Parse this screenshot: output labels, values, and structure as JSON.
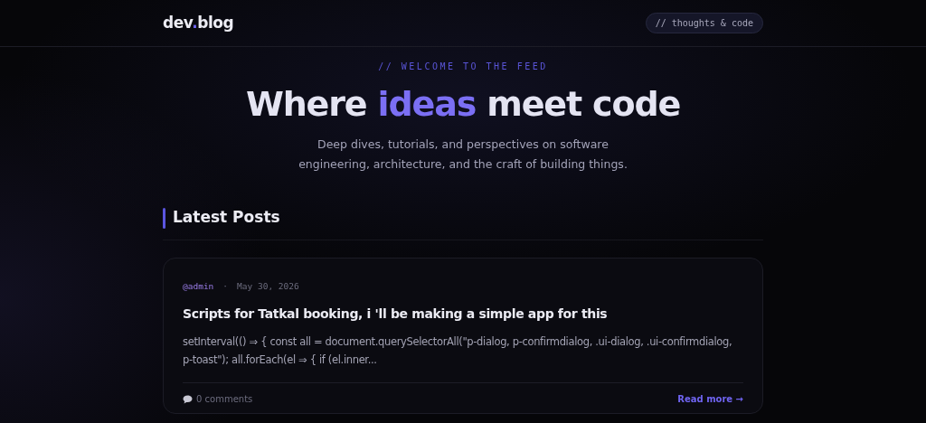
{
  "header": {
    "logo_parts": [
      {
        "text": "dev",
        "accent": false
      },
      {
        "text": ".",
        "accent": true
      },
      {
        "text": "blog",
        "accent": false
      }
    ],
    "tagline": "// thoughts & code"
  },
  "hero": {
    "eyebrow": "// WELCOME TO THE FEED",
    "title_parts": [
      {
        "text": "Where ",
        "accent": false
      },
      {
        "text": "ideas",
        "accent": true
      },
      {
        "text": " meet code",
        "accent": false
      }
    ],
    "subtitle": "Deep dives, tutorials, and perspectives on software engineering, architecture, and the craft of building things."
  },
  "section_title": "Latest Posts",
  "posts": [
    {
      "author": "@admin",
      "separator": "·",
      "date": "May 30, 2026",
      "title": "Scripts for Tatkal booking, i 'll be making a simple app for this",
      "excerpt": "setInterval(() ⇒ { const all = document.querySelectorAll(\"p-dialog, p-confirmdialog, .ui-dialog, .ui-confirmdialog, p-toast\"); all.forEach(el ⇒ { if (el.inner...",
      "comments": "0 comments",
      "read_more": "Read more →"
    }
  ]
}
